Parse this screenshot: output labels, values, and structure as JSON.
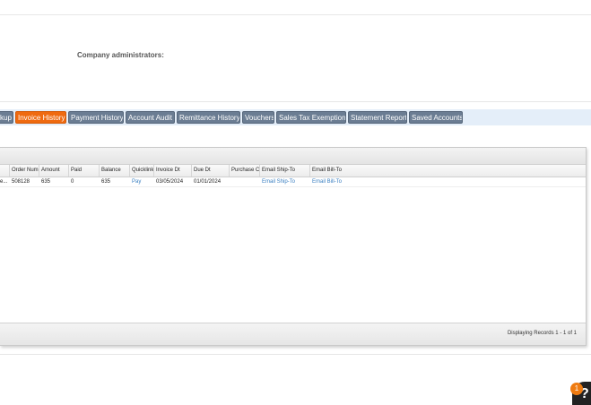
{
  "company": {
    "label": "Company administrators:"
  },
  "tabs": [
    {
      "label": "kup",
      "active": false
    },
    {
      "label": "Invoice History",
      "active": true
    },
    {
      "label": "Payment History",
      "active": false
    },
    {
      "label": "Account Audit",
      "active": false
    },
    {
      "label": "Remittance History",
      "active": false
    },
    {
      "label": "Vouchers",
      "active": false
    },
    {
      "label": "Sales Tax Exemptions",
      "active": false
    },
    {
      "label": "Statement Report",
      "active": false
    },
    {
      "label": "Saved Accounts",
      "active": false
    }
  ],
  "grid": {
    "columns": [
      "Order Num",
      "Amount",
      "Paid",
      "Balance",
      "Quicklink",
      "Invoice Dt",
      "Due Dt",
      "Purchase C",
      "Email Ship-To",
      "Email Bill-To"
    ],
    "rows": [
      [
        "e...",
        "508128",
        "635",
        "0",
        "635",
        "Pay",
        "03/05/2024",
        "01/01/2024",
        "",
        "Email Ship-To",
        "Email Bill-To"
      ]
    ],
    "footer": "Displaying Records 1 - 1 of 1"
  },
  "notifications": {
    "count": "1"
  },
  "help": {
    "icon": "help-icon",
    "glyph": "?"
  },
  "colors": {
    "accent": "#ef6a10",
    "tab": "#6b7d93",
    "tabbar": "#e4eef9",
    "link": "#3a7fc1"
  }
}
